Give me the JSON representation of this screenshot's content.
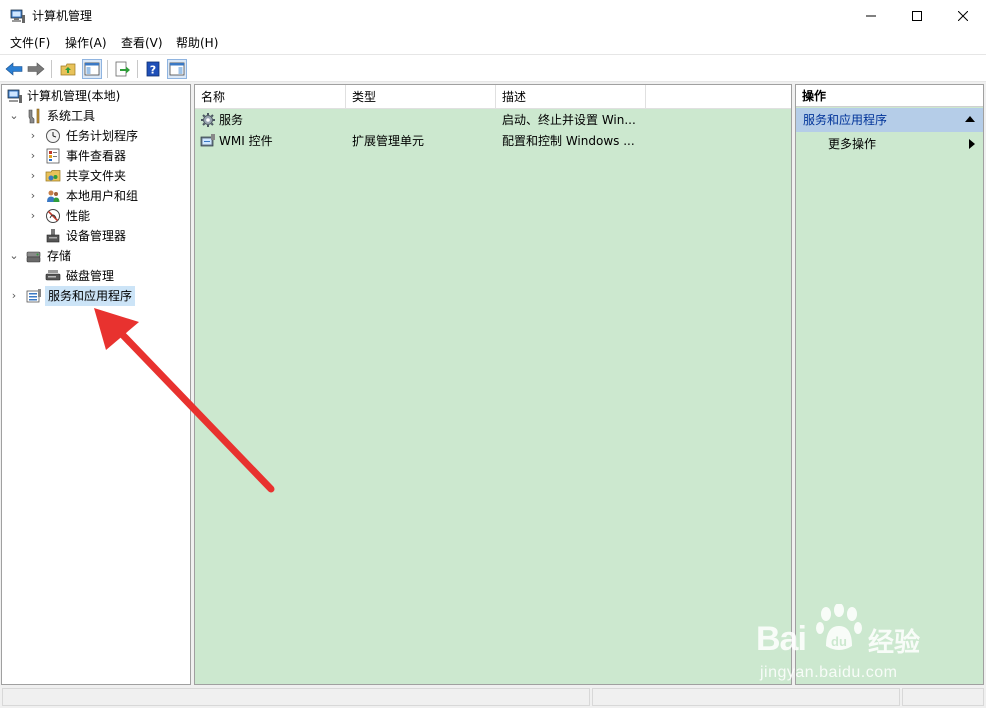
{
  "window": {
    "title": "计算机管理",
    "icon": "computer-management-icon"
  },
  "menu": [
    "文件(F)",
    "操作(A)",
    "查看(V)",
    "帮助(H)"
  ],
  "toolbar": {
    "buttons": [
      "back-arrow-icon",
      "forward-arrow-icon",
      "up-folder-icon",
      "show-hide-tree-icon",
      "export-list-icon",
      "help-icon",
      "show-hide-action-pane-icon"
    ]
  },
  "tree": {
    "root": "计算机管理(本地)",
    "system_tools": "系统工具",
    "task_scheduler": "任务计划程序",
    "event_viewer": "事件查看器",
    "shared_folders": "共享文件夹",
    "local_users": "本地用户和组",
    "performance": "性能",
    "device_manager": "设备管理器",
    "storage": "存储",
    "disk_management": "磁盘管理",
    "services_apps": "服务和应用程序",
    "expanders": {
      "expanded": "⌄",
      "collapsed": "›"
    }
  },
  "list": {
    "headers": [
      "名称",
      "类型",
      "描述"
    ],
    "rows": [
      {
        "name": "服务",
        "type": "",
        "description": "启动、终止并设置 Win...",
        "icon": "services-gear-icon"
      },
      {
        "name": "WMI 控件",
        "type": "扩展管理单元",
        "description": "配置和控制 Windows ...",
        "icon": "wmi-control-icon"
      }
    ]
  },
  "actions": {
    "header": "操作",
    "section": "服务和应用程序",
    "item": "更多操作"
  },
  "watermark": {
    "brand": "Bai",
    "suffix": "经验",
    "url": "jingyan.baidu.com"
  },
  "colors": {
    "content_bg": "#cce8cf",
    "selection": "#cce4f7",
    "action_section": "#b5cde8",
    "annotation_arrow": "#e8322f"
  }
}
